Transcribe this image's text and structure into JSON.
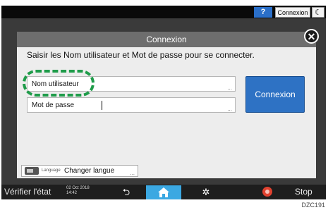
{
  "topbar": {
    "help": "?",
    "login": "Connexion",
    "moon": "☾"
  },
  "dialog": {
    "title": "Connexion",
    "close": "✕",
    "instructions": "Saisir les Nom utilisateur et Mot de passe pour se connecter.",
    "user_label": "Nom utilisateur",
    "password_label": "Mot de passe",
    "field_more": "...",
    "connect": "Connexion",
    "language_small": "Language",
    "language_label": "Changer langue"
  },
  "bottombar": {
    "check_status": "Vérifier l'état",
    "date": "02 Oct 2018",
    "time": "14:42",
    "back": "⮌",
    "settings": "✲",
    "stop": "Stop"
  },
  "caption": "DZC191"
}
